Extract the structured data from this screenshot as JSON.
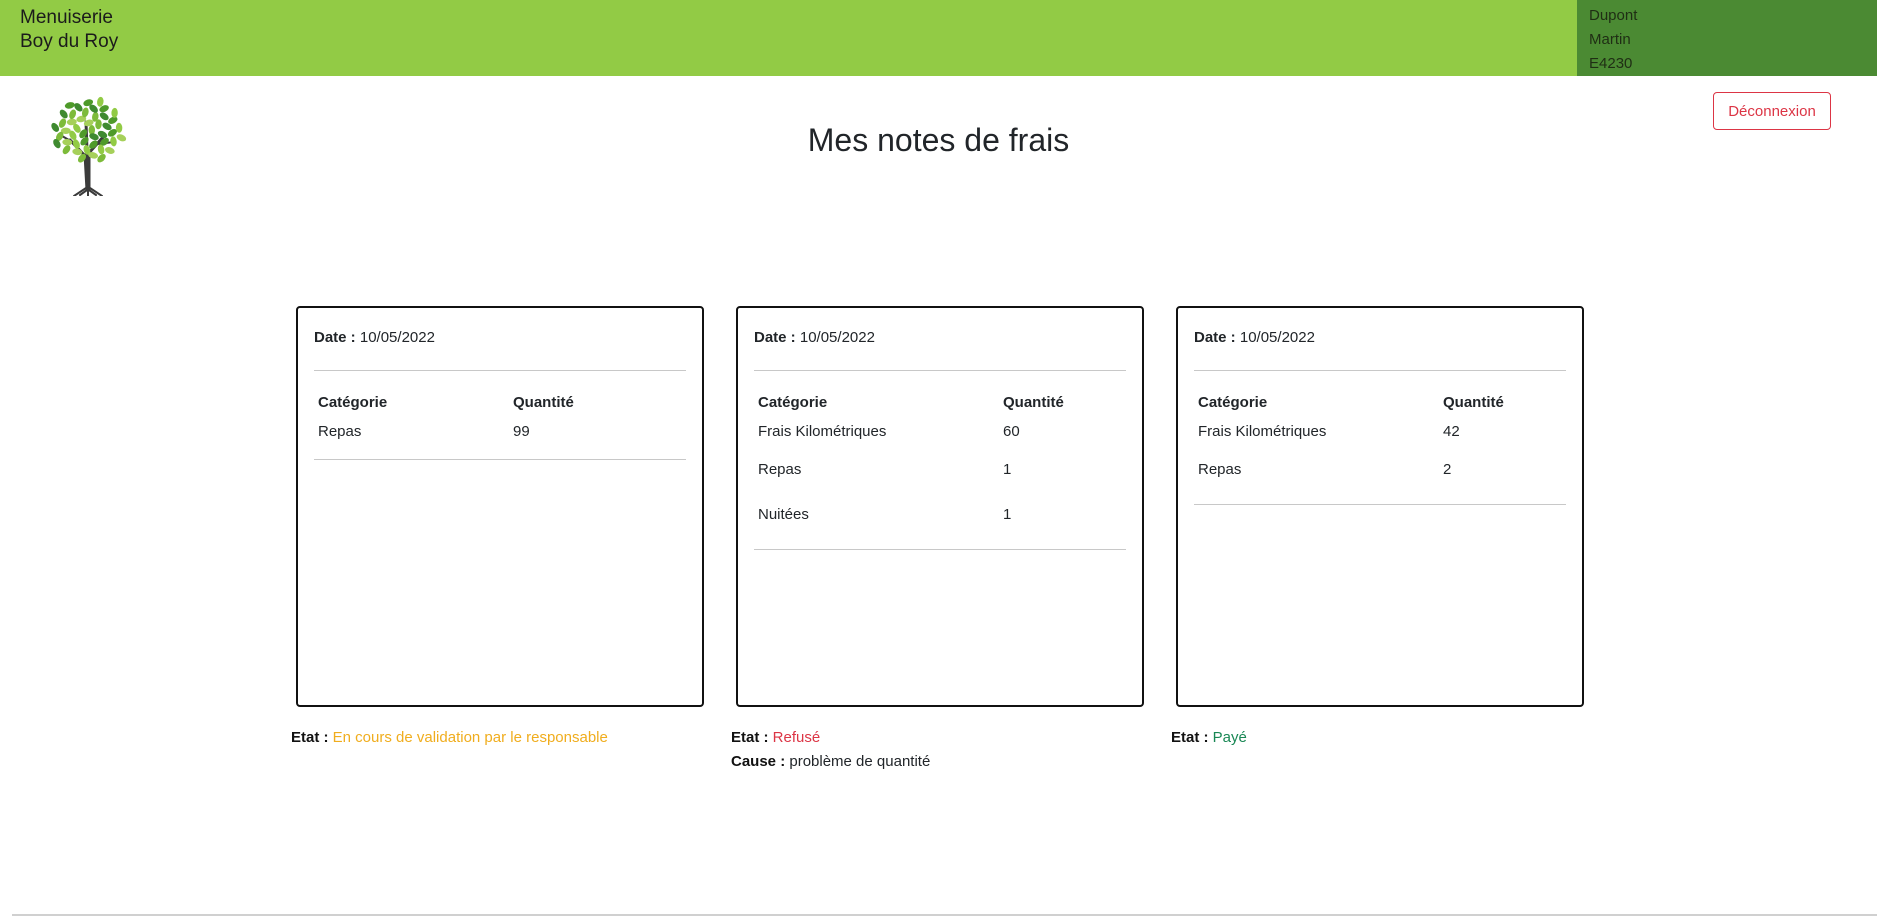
{
  "header": {
    "brand_line1": "Menuiserie",
    "brand_line2": "Boy du Roy",
    "user": {
      "lastname": "Dupont",
      "firstname": "Martin",
      "code": "E4230"
    },
    "colors": {
      "bar": "#92cb45",
      "user_panel": "#4b8a33"
    }
  },
  "page": {
    "title": "Mes notes de frais",
    "logout_label": "Déconnexion",
    "logo_icon": "tree-icon"
  },
  "labels": {
    "date": "Date :",
    "category": "Catégorie",
    "quantity": "Quantité",
    "state": "Etat :",
    "cause": "Cause :"
  },
  "notes": [
    {
      "date": "10/05/2022",
      "rows": [
        {
          "category": "Repas",
          "quantity": "99"
        }
      ],
      "state": "En cours de validation par le responsable",
      "state_color": "#f0ad1e",
      "cause": null
    },
    {
      "date": "10/05/2022",
      "rows": [
        {
          "category": "Frais Kilométriques",
          "quantity": "60"
        },
        {
          "category": "Repas",
          "quantity": "1"
        },
        {
          "category": "Nuitées",
          "quantity": "1"
        }
      ],
      "state": "Refusé",
      "state_color": "#dc3545",
      "cause": "problème de quantité"
    },
    {
      "date": "10/05/2022",
      "rows": [
        {
          "category": "Frais Kilométriques",
          "quantity": "42"
        },
        {
          "category": "Repas",
          "quantity": "2"
        }
      ],
      "state": "Payé",
      "state_color": "#198754",
      "cause": null
    }
  ]
}
